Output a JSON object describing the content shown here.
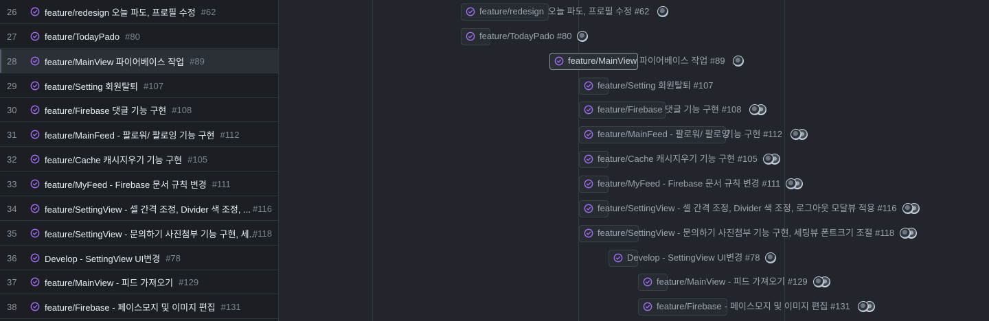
{
  "colors": {
    "check_icon": "#a371f7",
    "text": "#e6edf3",
    "muted": "#7d8590"
  },
  "rows": [
    {
      "num": "26",
      "title": "feature/redesign 오늘 파도, 프로필 수정",
      "ref": "#62",
      "tl_left": "feature/redesign",
      "tl_right": " 오늘 파도, 프로필 수정 #62",
      "avatars": 1
    },
    {
      "num": "27",
      "title": "feature/TodayPado",
      "ref": "#80",
      "tl_left": "feature/TodayPado #80",
      "tl_right": "",
      "avatars": 1
    },
    {
      "num": "28",
      "title": "feature/MainView 파이어베이스 작업",
      "ref": "#89",
      "tl_left": "feature/MainView",
      "tl_right": " 파이어베이스 작업 #89",
      "avatars": 1
    },
    {
      "num": "29",
      "title": "feature/Setting 회원탈퇴",
      "ref": "#107",
      "tl_left": "feature/Setting 회원탈퇴 #107",
      "tl_right": "",
      "avatars": 0
    },
    {
      "num": "30",
      "title": "feature/Firebase 댓글 기능 구현",
      "ref": "#108",
      "tl_left": "feature/Firebase",
      "tl_right": " 댓글 기능 구현 #108",
      "avatars": 2
    },
    {
      "num": "31",
      "title": "feature/MainFeed - 팔로워/ 팔로잉 기능 구현",
      "ref": "#112",
      "tl_left": "feature/MainFeed - 팔로워/ 팔로잉",
      "tl_right": " 기능 구현 #112",
      "avatars": 2
    },
    {
      "num": "32",
      "title": "feature/Cache 캐시지우기 기능 구현",
      "ref": "#105",
      "tl_left": "feature/Cache 캐시지우기 기능 구현 #105",
      "tl_right": "",
      "avatars": 2
    },
    {
      "num": "33",
      "title": "feature/MyFeed - Firebase 문서 규칙 변경",
      "ref": "#111",
      "tl_left": "feature/MyFeed - Firebase 문서 규칙 변경 #111",
      "tl_right": "",
      "avatars": 2
    },
    {
      "num": "34",
      "title": "feature/SettingView - 셀 간격 조정, Divider 색 조정, ...",
      "ref": "#116",
      "tl_left": "feature/SettingView - 셀 간격 조정, Divider 색 조정, 로그아웃 모달뷰 적용 #116",
      "tl_right": "",
      "avatars": 2
    },
    {
      "num": "35",
      "title": "feature/SettingView - 문의하기 사진첨부 기능 구현, 세...",
      "ref": "#118",
      "tl_left": "feature/SettingView - 문의하기 사진첨부 기능 구현, 세팅뷰 폰트크기 조절 #118",
      "tl_right": "",
      "avatars": 2
    },
    {
      "num": "36",
      "title": "Develop - SettingView UI변경",
      "ref": "#78",
      "tl_left": "Develop - SettingView UI변경 #78",
      "tl_right": "",
      "avatars": 1
    },
    {
      "num": "37",
      "title": "feature/MainView - 피드 가져오기",
      "ref": "#129",
      "tl_left": "feature/MainView - 피드 가져오기 #129",
      "tl_right": "",
      "avatars": 2
    },
    {
      "num": "38",
      "title": "feature/Firebase - 페이스모지 및 이미지 편집",
      "ref": "#131",
      "tl_left": "feature/Firebase",
      "tl_right": " - 페이스모지 및 이미지 편집 #131",
      "avatars": 2
    }
  ]
}
